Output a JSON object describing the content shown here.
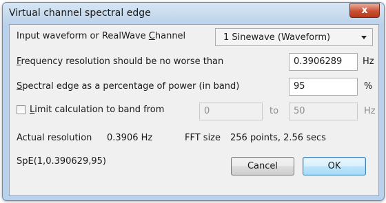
{
  "window": {
    "title": "Virtual channel spectral edge",
    "close_glyph": "x"
  },
  "input": {
    "label_pre": "Input waveform or RealWave ",
    "label_u": "C",
    "label_post": "hannel",
    "selected": "1 Sinewave (Waveform)"
  },
  "freq": {
    "label_u": "F",
    "label_post": "requency resolution should be no worse than",
    "value": "0.3906289",
    "unit": "Hz"
  },
  "edge": {
    "label_u": "S",
    "label_post": "pectral edge as a percentage of power (in band)",
    "value": "95",
    "unit": "%"
  },
  "band": {
    "label_u": "L",
    "label_post": "imit calculation to band from",
    "from_value": "0",
    "to_label": "to",
    "to_value": "50",
    "unit": "Hz",
    "checked": false
  },
  "info": {
    "resolution_label": "Actual resolution",
    "resolution_value": "0.3906 Hz",
    "fft_label": "FFT size",
    "fft_value": "256 points, 2.56 secs",
    "expression": "SpE(1,0.390629,95)"
  },
  "buttons": {
    "cancel": "Cancel",
    "ok": "OK"
  }
}
